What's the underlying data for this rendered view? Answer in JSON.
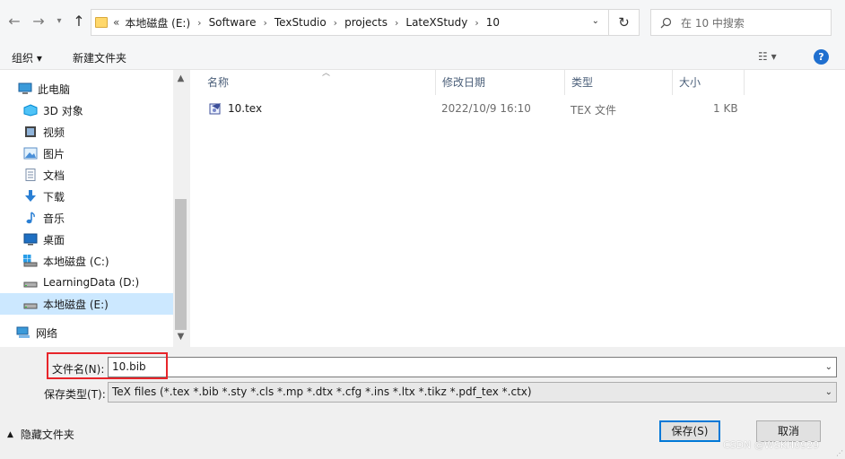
{
  "address_bar": {
    "overflow": "«",
    "crumbs": [
      "本地磁盘 (E:)",
      "Software",
      "TexStudio",
      "projects",
      "LateXStudy",
      "10"
    ],
    "search_placeholder": "在 10 中搜索"
  },
  "toolbar": {
    "organize": "组织 ▾",
    "new_folder": "新建文件夹"
  },
  "nav": {
    "items": [
      {
        "label": "此电脑"
      },
      {
        "label": "3D 对象"
      },
      {
        "label": "视频"
      },
      {
        "label": "图片"
      },
      {
        "label": "文档"
      },
      {
        "label": "下载"
      },
      {
        "label": "音乐"
      },
      {
        "label": "桌面"
      },
      {
        "label": "本地磁盘 (C:)"
      },
      {
        "label": "LearningData (D:)"
      },
      {
        "label": "本地磁盘 (E:)"
      },
      {
        "label": "网络"
      }
    ]
  },
  "file_list": {
    "columns": [
      "名称",
      "修改日期",
      "类型",
      "大小"
    ],
    "rows": [
      {
        "name": "10.tex",
        "modified": "2022/10/9 16:10",
        "type": "TEX 文件",
        "size": "1 KB"
      }
    ]
  },
  "save_form": {
    "filename_label": "文件名(N):",
    "filename_value": "10.bib",
    "filetype_label": "保存类型(T):",
    "filetype_value": "TeX files (*.tex *.bib *.sty *.cls *.mp *.dtx *.cfg *.ins *.ltx *.tikz *.pdf_tex *.ctx)"
  },
  "buttons": {
    "hide_folders": "隐藏文件夹",
    "save": "保存(S)",
    "cancel": "取消"
  },
  "watermark": "CSDN @WSKH0929",
  "colors": {
    "selection": "#cce8ff",
    "highlight_box": "#e8252a",
    "primary_border": "#0078d7"
  }
}
